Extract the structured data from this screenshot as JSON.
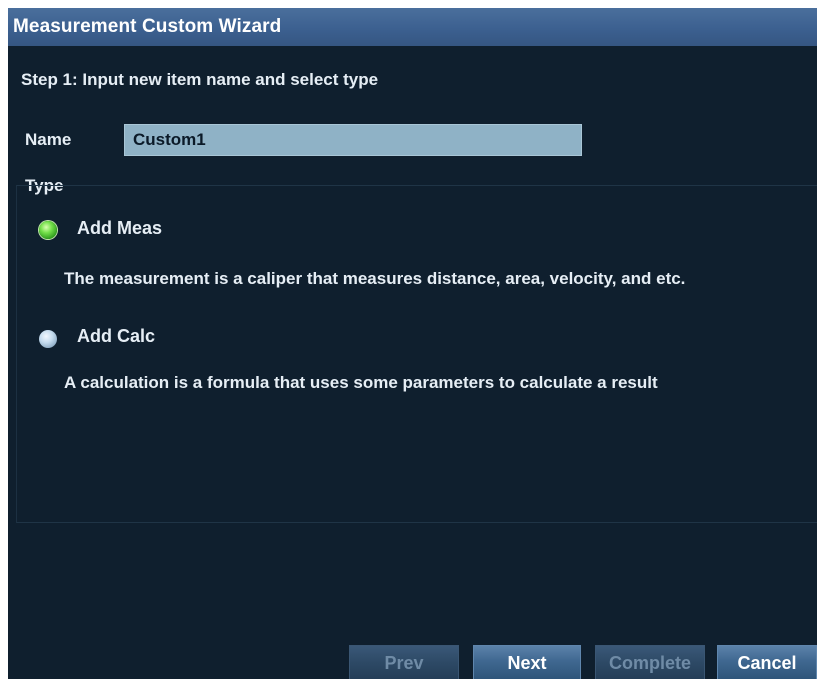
{
  "window": {
    "title": "Measurement Custom Wizard"
  },
  "step": {
    "label": "Step 1: Input new item name and select type"
  },
  "name_field": {
    "label": "Name",
    "value": "Custom1"
  },
  "type_group": {
    "label": "Type",
    "options": [
      {
        "label": "Add Meas",
        "description": "The measurement is a caliper that measures distance, area, velocity, and etc.",
        "selected": true
      },
      {
        "label": "Add Calc",
        "description": "A calculation is a formula that uses some parameters to calculate a result",
        "selected": false
      }
    ]
  },
  "buttons": {
    "prev": {
      "label": "Prev",
      "enabled": false
    },
    "next": {
      "label": "Next",
      "enabled": true
    },
    "complete": {
      "label": "Complete",
      "enabled": false
    },
    "cancel": {
      "label": "Cancel",
      "enabled": true
    }
  },
  "colors": {
    "background": "#0f1f2e",
    "titlebar": "#3c6090",
    "input_background": "#8fb2c6",
    "radio_selected": "#4cc22e",
    "radio_unselected": "#a9c4dc",
    "button": "#3f6790",
    "text": "#e6eef5"
  }
}
